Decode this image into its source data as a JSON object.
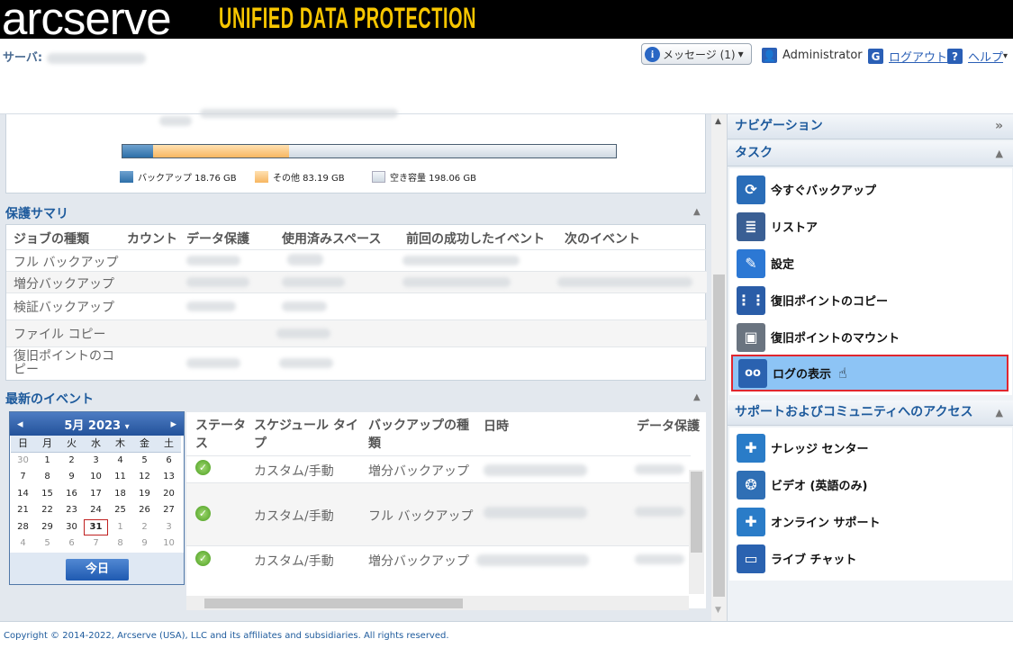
{
  "brand": {
    "logo": "arcserve",
    "logo_mark": "®",
    "product": "UNIFIED DATA PROTECTION",
    "colors": {
      "banner": "#000000",
      "product": "#f7c600"
    }
  },
  "header": {
    "server_label": "サーバ:",
    "messages_label": "メッセージ (1)",
    "messages_caret": "▾",
    "user": "Administrator",
    "logout": "ログアウト",
    "help": "ヘルプ",
    "help_caret": "▾"
  },
  "usage": {
    "backup_fraction": 0.062,
    "other_fraction": 0.275,
    "legend": {
      "backup": "バックアップ 18.76 GB",
      "other": "その他 83.19 GB",
      "free": "空き容量 198.06 GB"
    }
  },
  "summary": {
    "title": "保護サマリ",
    "columns": [
      "ジョブの種類",
      "カウント",
      "データ保護",
      "使用済みスペース",
      "前回の成功したイベント",
      "次のイベント"
    ],
    "rows": [
      {
        "type": "フル バックアップ"
      },
      {
        "type": "増分バックアップ"
      },
      {
        "type": "検証バックアップ"
      },
      {
        "type": "ファイル コピー"
      },
      {
        "type": "復旧ポイントのコピー"
      }
    ]
  },
  "events": {
    "title": "最新のイベント",
    "calendar": {
      "month_label": "5月 2023",
      "month_caret": "▾",
      "prev": "◂",
      "next": "▸",
      "day_names": [
        "日",
        "月",
        "火",
        "水",
        "木",
        "金",
        "土"
      ],
      "days": [
        "30",
        "1",
        "2",
        "3",
        "4",
        "5",
        "6",
        "7",
        "8",
        "9",
        "10",
        "11",
        "12",
        "13",
        "14",
        "15",
        "16",
        "17",
        "18",
        "19",
        "20",
        "21",
        "22",
        "23",
        "24",
        "25",
        "26",
        "27",
        "28",
        "29",
        "30",
        "31",
        "1",
        "2",
        "3",
        "4",
        "5",
        "6",
        "7",
        "8",
        "9",
        "10"
      ],
      "today_button": "今日"
    },
    "columns": [
      "ステータス",
      "スケジュール タイプ",
      "バックアップの種類",
      "日時",
      "データ保護"
    ],
    "rows": [
      {
        "status_icon": "check-icon",
        "schedule": "カスタム/手動",
        "kind": "増分バックアップ"
      },
      {
        "status_icon": "check-icon",
        "schedule": "カスタム/手動",
        "kind": "フル バックアップ"
      },
      {
        "status_icon": "check-icon",
        "schedule": "カスタム/手動",
        "kind": "増分バックアップ"
      }
    ]
  },
  "navigation": {
    "title": "ナビゲーション",
    "expand_icon": "»",
    "tasks_title": "タスク",
    "tasks": [
      {
        "label": "今すぐバックアップ",
        "icon": "backup-now-icon",
        "color": "#2a6db8"
      },
      {
        "label": "リストア",
        "icon": "restore-icon",
        "color": "#3a5f94"
      },
      {
        "label": "設定",
        "icon": "settings-wrench-icon",
        "color": "#2c78d4"
      },
      {
        "label": "復旧ポイントのコピー",
        "icon": "copy-recovery-point-icon",
        "color": "#2a5da8"
      },
      {
        "label": "復旧ポイントのマウント",
        "icon": "mount-recovery-point-icon",
        "color": "#6a7480"
      },
      {
        "label": "ログの表示",
        "icon": "view-log-icon",
        "color": "#2a62b0"
      }
    ],
    "support_title": "サポートおよびコミュニティへのアクセス",
    "support": [
      {
        "label": "ナレッジ センター",
        "icon": "knowledge-center-icon",
        "color": "#2a7cc8"
      },
      {
        "label": "ビデオ (英語のみ)",
        "icon": "video-icon",
        "color": "#2f6fb5"
      },
      {
        "label": "オンライン サポート",
        "icon": "online-support-icon",
        "color": "#2a7cc8"
      },
      {
        "label": "ライブ チャット",
        "icon": "live-chat-icon",
        "color": "#2a62b0"
      }
    ]
  },
  "footer": {
    "copyright": "Copyright © 2014-2022, Arcserve (USA), LLC and its affiliates and subsidiaries. All rights reserved."
  }
}
